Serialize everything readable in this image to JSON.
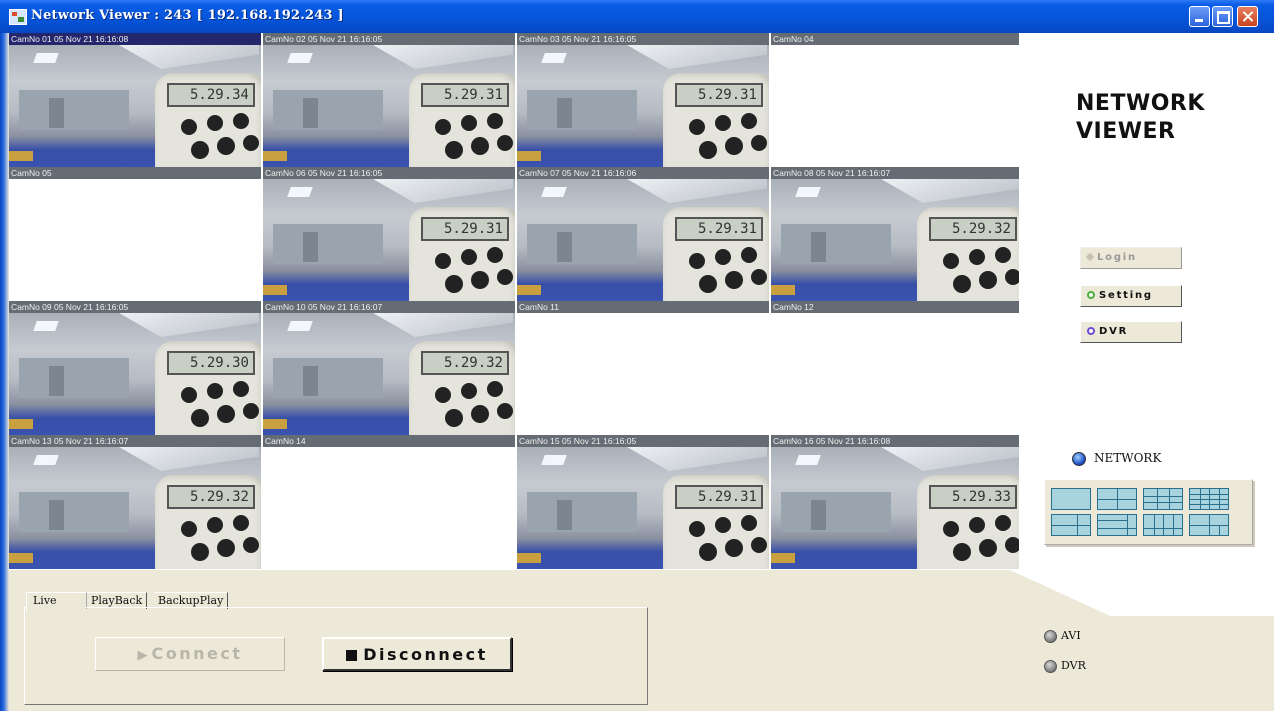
{
  "window": {
    "title": "Network Viewer : 243 [ 192.168.192.243 ]",
    "controls": [
      "minimize",
      "maximize",
      "close"
    ]
  },
  "cameras": [
    {
      "label": "CamNo 01 05 Nov 21 16:16:08",
      "has_video": true,
      "reading": "5.29.34",
      "selected": true
    },
    {
      "label": "CamNo 02 05 Nov 21 16:16:05",
      "has_video": true,
      "reading": "5.29.31",
      "selected": false
    },
    {
      "label": "CamNo 03 05 Nov 21 16:16:05",
      "has_video": true,
      "reading": "5.29.31",
      "selected": false
    },
    {
      "label": "CamNo 04",
      "has_video": false,
      "reading": "",
      "selected": false
    },
    {
      "label": "CamNo 05",
      "has_video": false,
      "reading": "",
      "selected": false
    },
    {
      "label": "CamNo 06 05 Nov 21 16:16:05",
      "has_video": true,
      "reading": "5.29.31",
      "selected": false
    },
    {
      "label": "CamNo 07 05 Nov 21 16:16:06",
      "has_video": true,
      "reading": "5.29.31",
      "selected": false
    },
    {
      "label": "CamNo 08 05 Nov 21 16:16:07",
      "has_video": true,
      "reading": "5.29.32",
      "selected": false
    },
    {
      "label": "CamNo 09 05 Nov 21 16:16:05",
      "has_video": true,
      "reading": "5.29.30",
      "selected": false
    },
    {
      "label": "CamNo 10 05 Nov 21 16:16:07",
      "has_video": true,
      "reading": "5.29.32",
      "selected": false
    },
    {
      "label": "CamNo 11",
      "has_video": false,
      "reading": "",
      "selected": false
    },
    {
      "label": "CamNo 12",
      "has_video": false,
      "reading": "",
      "selected": false
    },
    {
      "label": "CamNo 13 05 Nov 21 16:16:07",
      "has_video": true,
      "reading": "5.29.32",
      "selected": false
    },
    {
      "label": "CamNo 14",
      "has_video": false,
      "reading": "",
      "selected": false
    },
    {
      "label": "CamNo 15 05 Nov 21 16:16:05",
      "has_video": true,
      "reading": "5.29.31",
      "selected": false
    },
    {
      "label": "CamNo 16 05 Nov 21 16:16:08",
      "has_video": true,
      "reading": "5.29.33",
      "selected": false
    }
  ],
  "side": {
    "logo_line1": "NETWORK",
    "logo_line2": "VIEWER",
    "login_label": "Login",
    "login_enabled": false,
    "setting_label": "Setting",
    "dvr_label": "DVR",
    "network_label": "NETWORK",
    "layouts": [
      "1x1",
      "2x2",
      "3x3",
      "4x4",
      "1+5",
      "1+7",
      "1+12",
      "2+8"
    ]
  },
  "tabs": {
    "items": [
      {
        "label": "Live",
        "active": true
      },
      {
        "label": "PlayBack",
        "active": false
      },
      {
        "label": "BackupPlay",
        "active": false
      }
    ],
    "connect_label": "Connect",
    "connect_enabled": false,
    "disconnect_label": "Disconnect"
  },
  "record": {
    "avi_label": "AVI",
    "dvr_label": "DVR"
  }
}
